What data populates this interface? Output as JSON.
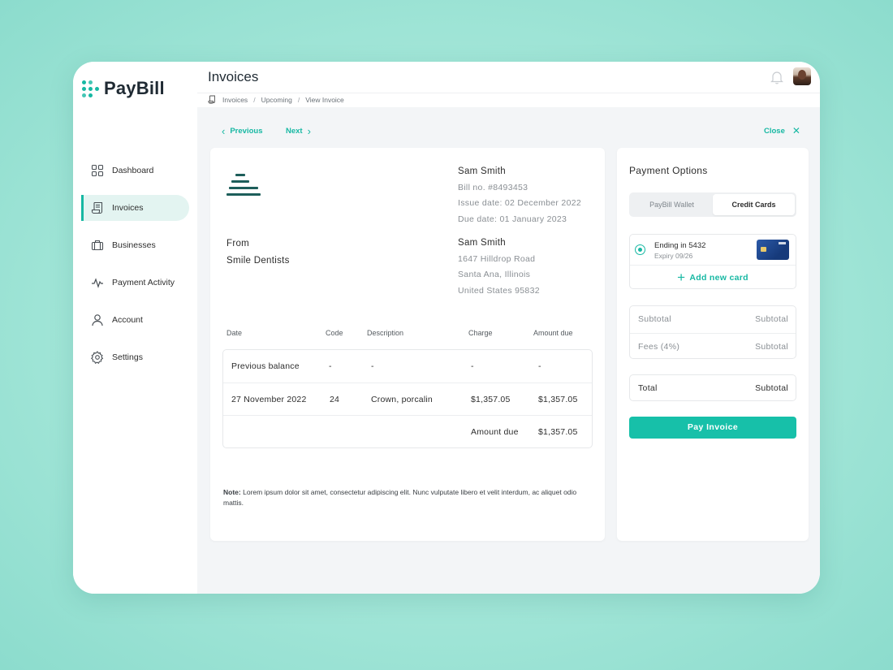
{
  "app": {
    "name": "PayBill"
  },
  "sidebar": {
    "items": [
      {
        "label": "Dashboard",
        "icon": "dashboard-grid-icon"
      },
      {
        "label": "Invoices",
        "icon": "invoice-icon",
        "active": true
      },
      {
        "label": "Businesses",
        "icon": "briefcase-icon"
      },
      {
        "label": "Payment Activity",
        "icon": "activity-pulse-icon"
      },
      {
        "label": "Account",
        "icon": "user-icon"
      },
      {
        "label": "Settings",
        "icon": "gear-icon"
      }
    ]
  },
  "header": {
    "title": "Invoices"
  },
  "breadcrumb": [
    "Invoices",
    "Upcoming",
    "View Invoice"
  ],
  "pager": {
    "previous": "Previous",
    "next": "Next",
    "close": "Close"
  },
  "invoice": {
    "bill_to": {
      "name": "Sam Smith",
      "bill_no": "Bill no. #8493453",
      "issue_date": "Issue date: 02 December 2022",
      "due_date": "Due date: 01 January 2023"
    },
    "from_label": "From",
    "from_name": "Smile Dentists",
    "address": {
      "name": "Sam Smith",
      "line1": "1647 Hilldrop Road",
      "line2": "Santa Ana, Illinois",
      "line3": "United States 95832"
    },
    "columns": [
      "Date",
      "Code",
      "Description",
      "Charge",
      "Amount due"
    ],
    "rows": [
      [
        "Previous balance",
        "-",
        "-",
        "-",
        "-"
      ],
      [
        "27 November 2022",
        "24",
        "Crown, porcalin",
        "$1,357.05",
        "$1,357.05"
      ]
    ],
    "amount_due_label": "Amount due",
    "amount_due_value": "$1,357.05",
    "note_label": "Note:",
    "note_text": "Lorem ipsum dolor sit amet, consectetur adipiscing elit. Nunc vulputate libero et velit interdum, ac aliquet odio mattis."
  },
  "payment": {
    "title": "Payment Options",
    "tabs": [
      "PayBill Wallet",
      "Credit Cards"
    ],
    "active_tab": "Credit Cards",
    "card": {
      "ending": "Ending  in 5432",
      "expiry": "Expiry 09/26"
    },
    "add_card": "Add new card",
    "subtotal_label": "Subtotal",
    "subtotal_value": "Subtotal",
    "fees_label": "Fees (4%)",
    "fees_value": "Subtotal",
    "total_label": "Total",
    "total_value": "Subtotal",
    "pay_button": "Pay Invoice"
  },
  "colors": {
    "accent": "#17b8a3",
    "button": "#17c0a9",
    "background": "#a3e6d8"
  }
}
